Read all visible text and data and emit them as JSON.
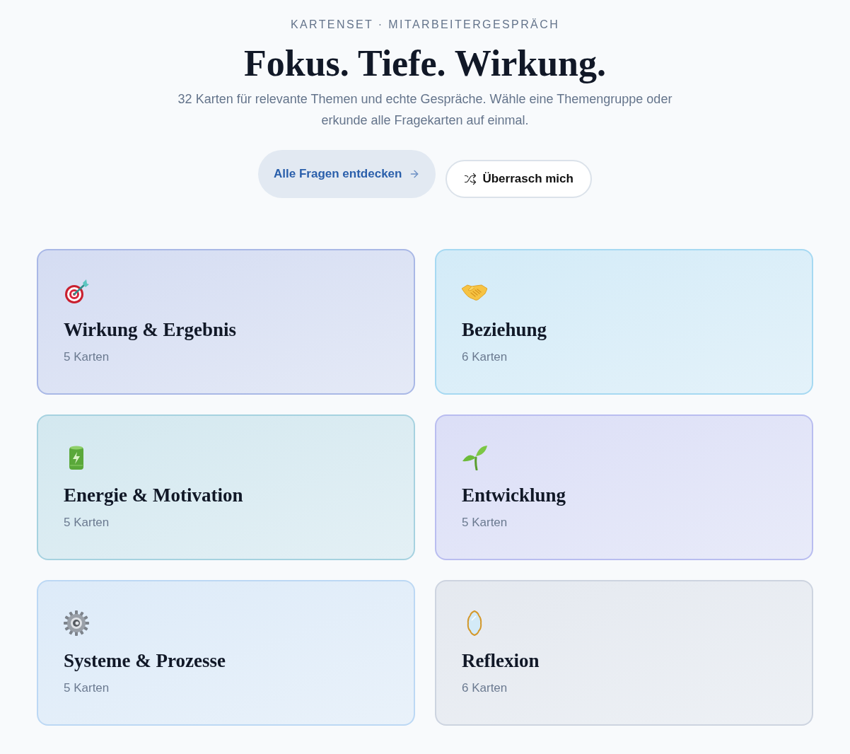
{
  "header": {
    "eyebrow": "KARTENSET · MITARBEITERGESPRÄCH",
    "title": "Fokus. Tiefe. Wirkung.",
    "subtitle": "32 Karten für relevante Themen und echte Gespräche. Wähle eine Themengruppe oder erkunde alle Fragekarten auf einmal."
  },
  "actions": [
    {
      "label": "Alle Fragen entdecken",
      "kind": "primary"
    },
    {
      "label": "Überrasch mich",
      "kind": "secondary"
    }
  ],
  "topics": [
    {
      "title": "Wirkung & Ergebnis",
      "count": "5 Karten",
      "color": "#a9b8e6"
    },
    {
      "title": "Beziehung",
      "count": "6 Karten",
      "color": "#a6d9f2"
    },
    {
      "title": "Energie & Motivation",
      "count": "5 Karten",
      "color": "#a6d2e0"
    },
    {
      "title": "Entwicklung",
      "count": "5 Karten",
      "color": "#b9bdf0"
    },
    {
      "title": "Systeme & Prozesse",
      "count": "5 Karten",
      "color": "#bcd8f4"
    },
    {
      "title": "Reflexion",
      "count": "6 Karten",
      "color": "#cdd4e0"
    }
  ]
}
